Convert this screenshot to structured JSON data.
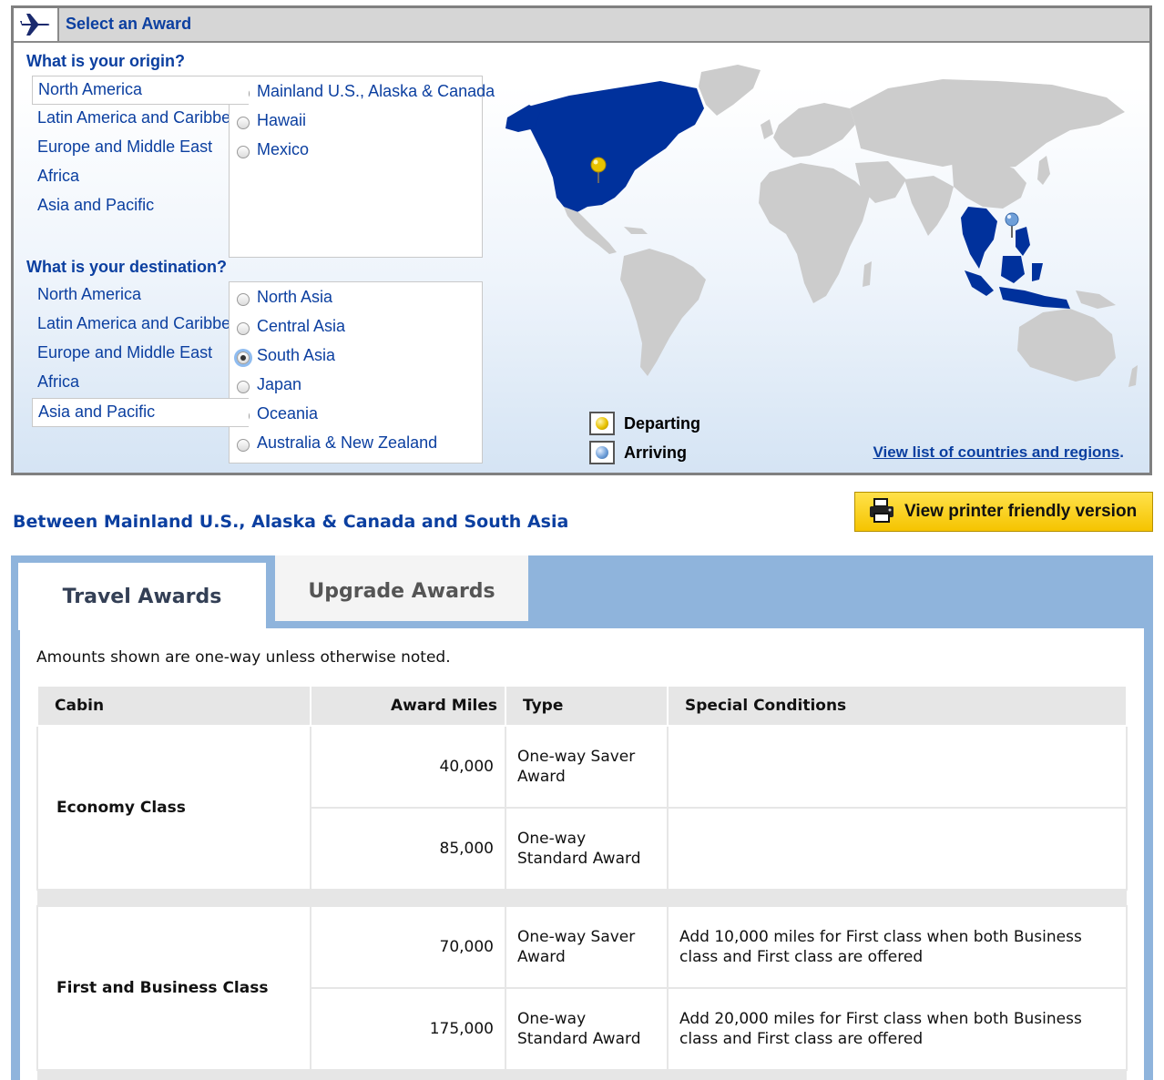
{
  "header": {
    "title": "Select an Award"
  },
  "origin": {
    "question": "What is your origin?",
    "regions": [
      "North America",
      "Latin America and Caribbean",
      "Europe and Middle East",
      "Africa",
      "Asia and Pacific"
    ],
    "selected_region": "North America",
    "subregions": [
      {
        "label": "Mainland U.S., Alaska & Canada",
        "checked": true
      },
      {
        "label": "Hawaii",
        "checked": false
      },
      {
        "label": "Mexico",
        "checked": false
      }
    ]
  },
  "destination": {
    "question": "What is your destination?",
    "regions": [
      "North America",
      "Latin America and Caribbean",
      "Europe and Middle East",
      "Africa",
      "Asia and Pacific"
    ],
    "selected_region": "Asia and Pacific",
    "subregions": [
      {
        "label": "North Asia",
        "checked": false
      },
      {
        "label": "Central Asia",
        "checked": false
      },
      {
        "label": "South Asia",
        "checked": true
      },
      {
        "label": "Japan",
        "checked": false
      },
      {
        "label": "Oceania",
        "checked": false
      },
      {
        "label": "Australia & New Zealand",
        "checked": false
      }
    ]
  },
  "legend": {
    "departing": "Departing",
    "arriving": "Arriving"
  },
  "countries_link": "View list of countries and regions",
  "route_title": "Between Mainland U.S., Alaska & Canada and South Asia",
  "print_button": "View printer friendly version",
  "tabs": {
    "travel": "Travel Awards",
    "upgrade": "Upgrade Awards"
  },
  "note": "Amounts shown are one-way unless otherwise noted.",
  "table": {
    "headers": {
      "cabin": "Cabin",
      "miles": "Award Miles",
      "type": "Type",
      "conditions": "Special Conditions"
    },
    "economy": {
      "cabin": "Economy Class",
      "rows": [
        {
          "miles": "40,000",
          "type": "One-way Saver Award",
          "conditions": ""
        },
        {
          "miles": "85,000",
          "type": "One-way Standard Award",
          "conditions": ""
        }
      ]
    },
    "first": {
      "cabin": "First and Business Class",
      "rows": [
        {
          "miles": "70,000",
          "type": "One-way Saver Award",
          "conditions": "Add 10,000 miles for First class when both Business class and First class are offered"
        },
        {
          "miles": "175,000",
          "type": "One-way Standard Award",
          "conditions": "Add 20,000 miles for First class when both Business class and First class are offered"
        }
      ]
    }
  },
  "colors": {
    "link_blue": "#0b3fa0",
    "map_highlight": "#00319c",
    "map_land": "#cccccc",
    "tab_border": "#8fb4dc",
    "button_yellow": "#f5c400"
  }
}
